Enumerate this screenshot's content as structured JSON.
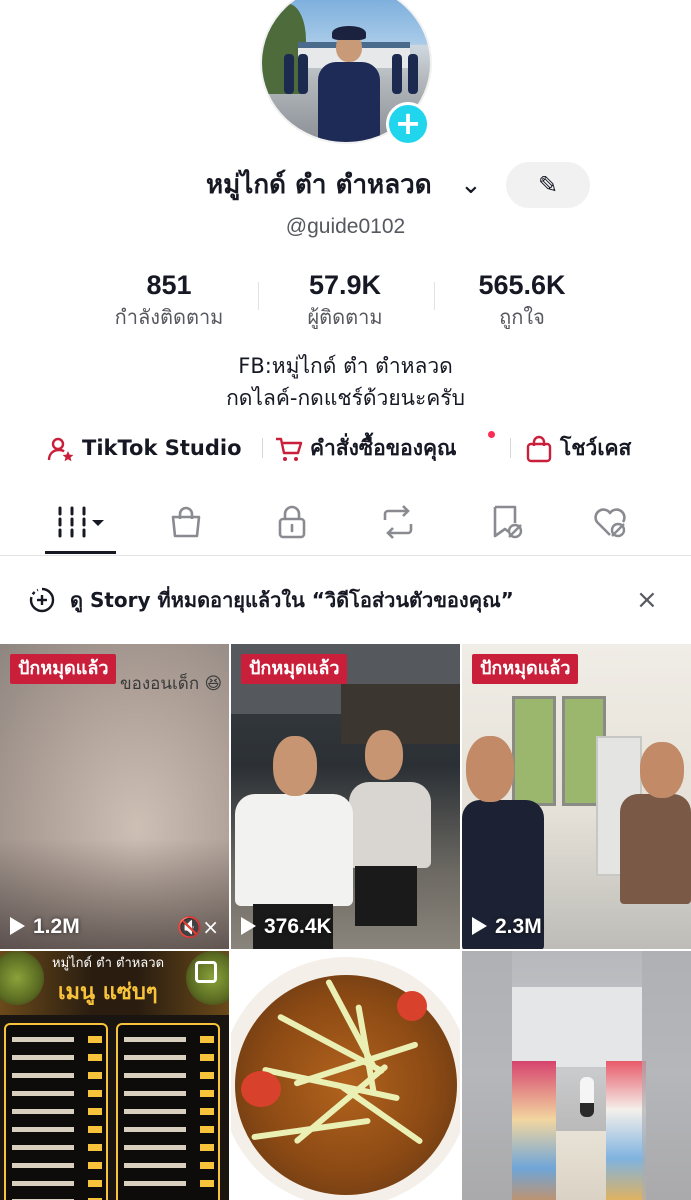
{
  "profile": {
    "display_name": "หมู่ไกด์ ตำ ตำหลวด",
    "username": "@guide0102",
    "add_glyph": "+",
    "chevron_glyph": "⌄",
    "edit_glyph": "✎",
    "stats": [
      {
        "value": "851",
        "label": "กำลังติดตาม"
      },
      {
        "value": "57.9K",
        "label": "ผู้ติดตาม"
      },
      {
        "value": "565.6K",
        "label": "ถูกใจ"
      }
    ],
    "bio_lines": [
      "FB:หมู่ไกด์ ตำ ตำหลวด",
      "กดไลค์-กดแชร์ด้วยนะครับ"
    ]
  },
  "links": [
    {
      "label": "TikTok Studio",
      "icon": "person-star-icon"
    },
    {
      "label": "คำสั่งซื้อของคุณ",
      "icon": "cart-icon"
    },
    {
      "label": "โชว์เคส",
      "icon": "shopping-bag-icon"
    }
  ],
  "tabs": [
    {
      "icon": "videos-grid-icon",
      "selected": true
    },
    {
      "icon": "shop-bag-icon"
    },
    {
      "icon": "lock-icon"
    },
    {
      "icon": "repost-icon"
    },
    {
      "icon": "favorites-icon"
    },
    {
      "icon": "liked-icon"
    }
  ],
  "story_banner": {
    "text": "ดู Story ที่หมดอายุแล้วใน “วิดีโอส่วนตัวของคุณ”",
    "close_glyph": "×"
  },
  "videos": [
    {
      "pinned_label": "ปักหมุดแล้ว",
      "views": "1.2M",
      "caption": "ของอนเด็ก 😆",
      "muted": true,
      "mute_glyph": "🔇×"
    },
    {
      "pinned_label": "ปักหมุดแล้ว",
      "views": "376.4K"
    },
    {
      "pinned_label": "ปักหมุดแล้ว",
      "views": "2.3M"
    },
    {
      "poster_title_top": "หมู่ไกด์ ตำ ตำหลวด",
      "poster_title": "เมนู แซ่บๆ"
    },
    {},
    {}
  ],
  "colors": {
    "accent_cyan": "#20d5ec",
    "pinned_red": "#ca1f3a",
    "notification_red": "#fe2c55",
    "text_primary": "#161823",
    "text_secondary": "#57585f"
  }
}
